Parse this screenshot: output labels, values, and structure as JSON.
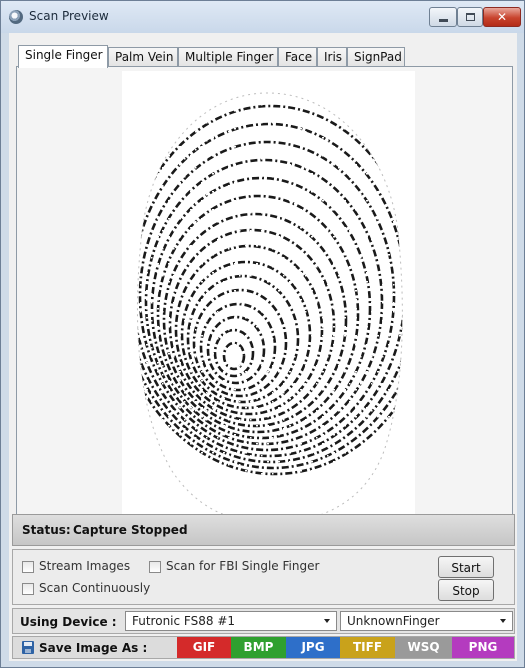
{
  "window": {
    "title": "Scan Preview"
  },
  "tabs": [
    {
      "label": "Single Finger",
      "active": true
    },
    {
      "label": "Palm Vein",
      "active": false
    },
    {
      "label": "Multiple Finger",
      "active": false
    },
    {
      "label": "Face",
      "active": false
    },
    {
      "label": "Iris",
      "active": false
    },
    {
      "label": "SignPad",
      "active": false
    }
  ],
  "status": {
    "label": "Status:",
    "value": "Capture Stopped"
  },
  "options": {
    "stream_images": {
      "label": "Stream Images",
      "checked": false
    },
    "scan_fbi": {
      "label": "Scan for FBI Single Finger",
      "checked": false
    },
    "scan_continuously": {
      "label": "Scan Continuously",
      "checked": false
    },
    "start_label": "Start",
    "stop_label": "Stop"
  },
  "device": {
    "label": "Using Device :",
    "selected_device": "Futronic FS88 #1",
    "selected_finger": "UnknownFinger"
  },
  "save": {
    "label": "Save Image As :",
    "formats": [
      {
        "label": "GIF",
        "color": "#d42a2a"
      },
      {
        "label": "BMP",
        "color": "#2fa02f"
      },
      {
        "label": "JPG",
        "color": "#2e6fc9"
      },
      {
        "label": "TIFF",
        "color": "#c9a21b"
      },
      {
        "label": "WSQ",
        "color": "#9a9a9a"
      },
      {
        "label": "PNG",
        "color": "#b43bbf"
      }
    ]
  }
}
